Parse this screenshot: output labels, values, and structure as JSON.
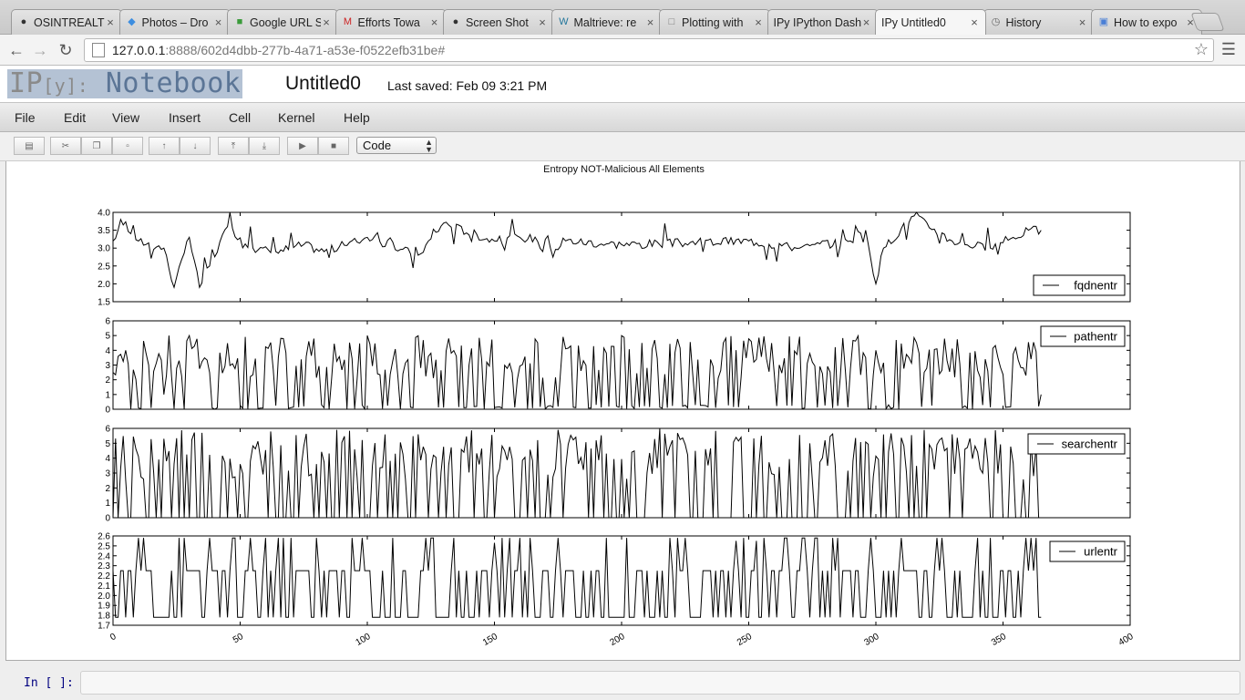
{
  "browser": {
    "tabs": [
      {
        "title": "OSINTREALTI",
        "icon": "github-icon",
        "active": false
      },
      {
        "title": "Photos – Dro",
        "icon": "dropbox-icon",
        "active": false
      },
      {
        "title": "Google URL S",
        "icon": "google-icon",
        "active": false
      },
      {
        "title": "Efforts Towa",
        "icon": "gmail-icon",
        "active": false
      },
      {
        "title": "Screen Shot",
        "icon": "github-icon",
        "active": false
      },
      {
        "title": "Maltrieve: re",
        "icon": "wordpress-icon",
        "active": false
      },
      {
        "title": "Plotting with",
        "icon": "page-icon",
        "active": false
      },
      {
        "title": "IPy IPython Dash",
        "icon": "",
        "active": false
      },
      {
        "title": "IPy Untitled0",
        "icon": "",
        "active": true
      },
      {
        "title": "History",
        "icon": "history-icon",
        "active": false
      },
      {
        "title": "How to expo",
        "icon": "docs-icon",
        "active": false
      }
    ],
    "url_host": "127.0.0.1",
    "url_rest": ":8888/602d4dbb-277b-4a71-a53e-f0522efb31be#"
  },
  "notebook": {
    "logo_ip": "IP",
    "logo_y": "[y]:",
    "logo_nb": "Notebook",
    "name": "Untitled0",
    "last_saved": "Last saved: Feb 09 3:21 PM",
    "menus": [
      "File",
      "Edit",
      "View",
      "Insert",
      "Cell",
      "Kernel",
      "Help"
    ],
    "cell_type": "Code",
    "input_prompt": "In [ ]:"
  },
  "chart_data": {
    "type": "line",
    "title": "Entropy NOT-Malicious All Elements",
    "x_range": [
      0,
      400
    ],
    "x_ticks": [
      0,
      50,
      100,
      150,
      200,
      250,
      300,
      350,
      400
    ],
    "n_points": 366,
    "legend_position": "right",
    "series": [
      {
        "name": "fqdnentr",
        "ylim": [
          1.5,
          4.0
        ],
        "yticks": [
          "1.5",
          "2.0",
          "2.5",
          "3.0",
          "3.5",
          "4.0"
        ],
        "legend_loc": "lower right",
        "key_points": [
          [
            0,
            3.2
          ],
          [
            3,
            3.8
          ],
          [
            10,
            3.2
          ],
          [
            20,
            3.0
          ],
          [
            24,
            1.9
          ],
          [
            30,
            3.3
          ],
          [
            34,
            1.9
          ],
          [
            45,
            3.6
          ],
          [
            55,
            3.0
          ],
          [
            64,
            2.9
          ],
          [
            75,
            3.1
          ],
          [
            83,
            2.9
          ],
          [
            100,
            3.3
          ],
          [
            120,
            2.8
          ],
          [
            130,
            3.7
          ],
          [
            150,
            3.2
          ],
          [
            160,
            3.3
          ],
          [
            200,
            3.1
          ],
          [
            250,
            3.2
          ],
          [
            270,
            3.0
          ],
          [
            290,
            3.2
          ],
          [
            296,
            3.5
          ],
          [
            300,
            2.0
          ],
          [
            303,
            3.0
          ],
          [
            315,
            3.9
          ],
          [
            330,
            3.2
          ],
          [
            345,
            3.0
          ],
          [
            360,
            3.5
          ],
          [
            365,
            3.5
          ]
        ]
      },
      {
        "name": "pathentr",
        "ylim": [
          0,
          6
        ],
        "yticks": [
          "0",
          "1",
          "2",
          "3",
          "4",
          "5",
          "6"
        ],
        "legend_loc": "upper right",
        "key_points": [
          [
            0,
            2.5
          ],
          [
            5,
            4.0
          ],
          [
            20,
            1.0
          ],
          [
            22,
            5.0
          ],
          [
            28,
            0
          ],
          [
            30,
            5.0
          ],
          [
            40,
            0
          ],
          [
            100,
            5.0
          ],
          [
            140,
            3.0
          ],
          [
            200,
            5.0
          ],
          [
            210,
            2.8
          ],
          [
            240,
            4.5
          ],
          [
            260,
            2.5
          ],
          [
            300,
            4.0
          ],
          [
            365,
            1.0
          ]
        ]
      },
      {
        "name": "searchentr",
        "ylim": [
          0,
          6
        ],
        "yticks": [
          "0",
          "1",
          "2",
          "3",
          "4",
          "5",
          "6"
        ],
        "legend_loc": "upper right",
        "key_points": [
          [
            0,
            0
          ],
          [
            12,
            2.6
          ],
          [
            20,
            5.3
          ],
          [
            35,
            5.7
          ],
          [
            50,
            3.6
          ],
          [
            80,
            3.6
          ],
          [
            120,
            5.6
          ],
          [
            175,
            5.9
          ],
          [
            190,
            5.2
          ],
          [
            215,
            6.0
          ],
          [
            245,
            5.4
          ],
          [
            255,
            5.5
          ],
          [
            280,
            5.2
          ],
          [
            330,
            5.6
          ],
          [
            362,
            2.8
          ],
          [
            365,
            0
          ]
        ]
      },
      {
        "name": "urlentr",
        "ylim": [
          1.7,
          2.6
        ],
        "yticks": [
          "1.7",
          "1.8",
          "1.9",
          "2.0",
          "2.1",
          "2.2",
          "2.3",
          "2.4",
          "2.5",
          "2.6"
        ],
        "legend_loc": "upper right",
        "key_points": [
          [
            0,
            2.25
          ],
          [
            5,
            1.78
          ],
          [
            12,
            2.58
          ],
          [
            26,
            2.58
          ],
          [
            60,
            2.58
          ],
          [
            80,
            2.58
          ],
          [
            98,
            2.58
          ],
          [
            110,
            2.58
          ],
          [
            150,
            2.53
          ],
          [
            175,
            2.58
          ],
          [
            180,
            2.25
          ],
          [
            245,
            2.55
          ],
          [
            253,
            2.55
          ],
          [
            283,
            2.58
          ],
          [
            360,
            2.25
          ],
          [
            365,
            1.78
          ]
        ]
      }
    ]
  }
}
